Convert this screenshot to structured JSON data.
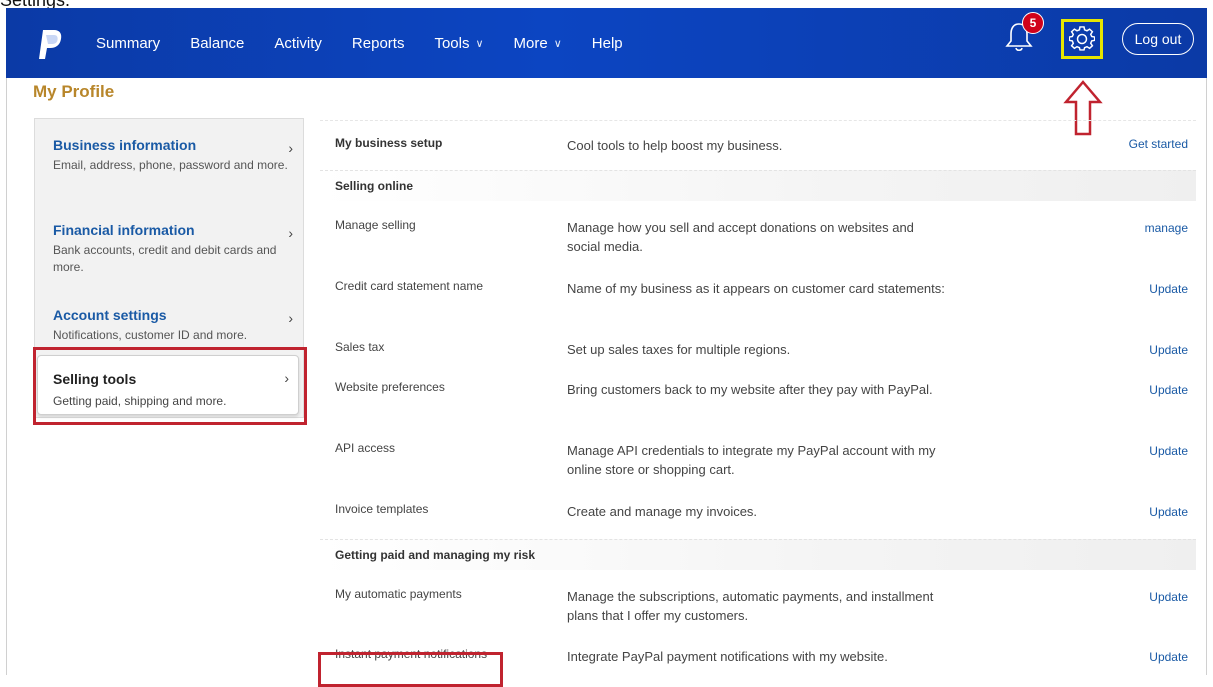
{
  "caption": "Settings.",
  "nav": {
    "links": [
      {
        "label": "Summary",
        "has_menu": false
      },
      {
        "label": "Balance",
        "has_menu": false
      },
      {
        "label": "Activity",
        "has_menu": false
      },
      {
        "label": "Reports",
        "has_menu": false
      },
      {
        "label": "Tools",
        "has_menu": true
      },
      {
        "label": "More",
        "has_menu": true
      },
      {
        "label": "Help",
        "has_menu": false
      }
    ],
    "notification_count": "5",
    "logout_label": "Log out",
    "icons": [
      "paypal-logo",
      "bell-icon",
      "gear-icon",
      "chevron-down-icon"
    ]
  },
  "page_title": "My Profile",
  "left_menu": [
    {
      "title": "Business information",
      "desc": "Email, address, phone, password and more."
    },
    {
      "title": "Financial information",
      "desc": "Bank accounts, credit and debit cards and more."
    },
    {
      "title": "Account settings",
      "desc": "Notifications, customer ID and more."
    },
    {
      "title": "Selling tools",
      "desc": "Getting paid, shipping and more."
    }
  ],
  "rows": {
    "setup": {
      "name": "My business setup",
      "desc": "Cool tools to help boost my business.",
      "action": "Get started"
    },
    "section1": "Selling online",
    "s1": [
      {
        "name": "Manage selling",
        "desc": "Manage how you sell and accept donations on websites and social media.",
        "action": "manage"
      },
      {
        "name": "Credit card statement name",
        "desc": "Name of my business as it appears on customer card statements:",
        "action": "Update"
      },
      {
        "name": "Sales tax",
        "desc": "Set up sales taxes for multiple regions.",
        "action": "Update"
      },
      {
        "name": "Website preferences",
        "desc": "Bring customers back to my website after they pay with PayPal.",
        "action": "Update"
      },
      {
        "name": "API access",
        "desc": "Manage API credentials to integrate my PayPal account with my online store or shopping cart.",
        "action": "Update"
      },
      {
        "name": "Invoice templates",
        "desc": "Create and manage my invoices.",
        "action": "Update"
      }
    ],
    "section2": "Getting paid and managing my risk",
    "s2": [
      {
        "name": "My automatic payments",
        "desc": "Manage the subscriptions, automatic payments, and installment plans that I offer my customers.",
        "action": "Update"
      },
      {
        "name": "Instant payment notifications",
        "desc": "Integrate PayPal payment notifications with my website.",
        "action": "Update"
      }
    ]
  },
  "colors": {
    "nav_bg": "#0c45c2",
    "highlight_yellow": "#e6e600",
    "highlight_red": "#c0232f",
    "title_gold": "#b8862a",
    "link_blue": "#1a5aa5"
  }
}
